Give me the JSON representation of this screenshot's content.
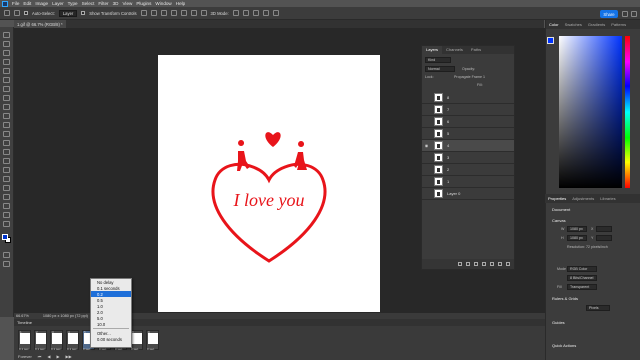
{
  "menu": [
    "File",
    "Edit",
    "Image",
    "Layer",
    "Type",
    "Select",
    "Filter",
    "3D",
    "View",
    "Plugins",
    "Window",
    "Help"
  ],
  "options": {
    "auto_select_label": "Auto-Select:",
    "auto_select_value": "Layer",
    "show_transform_label": "Show Transform Controls",
    "mode_label": "3D Mode:",
    "share_label": "Share"
  },
  "document": {
    "tab_title": "1.gif @ 66.7% (RGB/8) *",
    "text": "I love you",
    "zoom": "66.67%",
    "size_info": "1080 px x 1080 px (72 ppi)"
  },
  "layers_panel": {
    "tabs": [
      "Layers",
      "Channels",
      "Paths"
    ],
    "kind_label": "Kind",
    "blend": "Normal",
    "opacity_label": "Opacity:",
    "propagate_label": "Propagate Frame 1",
    "lock_label": "Lock:",
    "fill_label": "Fill:",
    "rows": [
      {
        "name": "8",
        "visible": false
      },
      {
        "name": "7",
        "visible": false
      },
      {
        "name": "6",
        "visible": false
      },
      {
        "name": "5",
        "visible": false
      },
      {
        "name": "4",
        "visible": true
      },
      {
        "name": "3",
        "visible": false
      },
      {
        "name": "2",
        "visible": false
      },
      {
        "name": "1",
        "visible": false
      },
      {
        "name": "Layer 0",
        "visible": false
      }
    ]
  },
  "color_panel": {
    "tabs": [
      "Color",
      "Swatches",
      "Gradients",
      "Patterns"
    ],
    "fg_color": "#0033ff",
    "bg_color": "#ffffff"
  },
  "properties_panel": {
    "tabs": [
      "Properties",
      "Adjustments",
      "Libraries"
    ],
    "doc_label": "Document",
    "canvas_title": "Canvas",
    "w_label": "W",
    "w_value": "1080 px",
    "h_label": "H",
    "h_value": "1080 px",
    "x_label": "X",
    "y_label": "Y",
    "resolution": "Resolution: 72 pixels/inch",
    "mode_label": "Mode",
    "mode_value": "RGB Color",
    "bits_value": "8 Bits/Channel",
    "fill_label": "Fill",
    "fill_value": "Transparent",
    "rulers_title": "Rulers & Grids",
    "rulers_unit": "Pixels",
    "guides_title": "Guides",
    "quick_actions": "Quick Actions"
  },
  "timeline": {
    "title": "Timeline",
    "frames": [
      {
        "num": "1",
        "delay": "0.1 sec."
      },
      {
        "num": "2",
        "delay": "0.1 sec."
      },
      {
        "num": "3",
        "delay": "0.1 sec."
      },
      {
        "num": "4",
        "delay": "0.1 sec."
      },
      {
        "num": "5",
        "delay": "0 sec."
      },
      {
        "num": "6",
        "delay": "0 sec."
      },
      {
        "num": "7",
        "delay": "0 sec."
      },
      {
        "num": "8",
        "delay": "0 sec."
      },
      {
        "num": "9",
        "delay": "0 sec."
      }
    ],
    "loop_label": "Forever"
  },
  "delay_popup": {
    "options": [
      "No delay",
      "0.1 seconds",
      "0.2",
      "0.5",
      "1.0",
      "2.0",
      "5.0",
      "10.0",
      "Other...",
      "0.00 seconds"
    ],
    "selected_index": 2
  }
}
